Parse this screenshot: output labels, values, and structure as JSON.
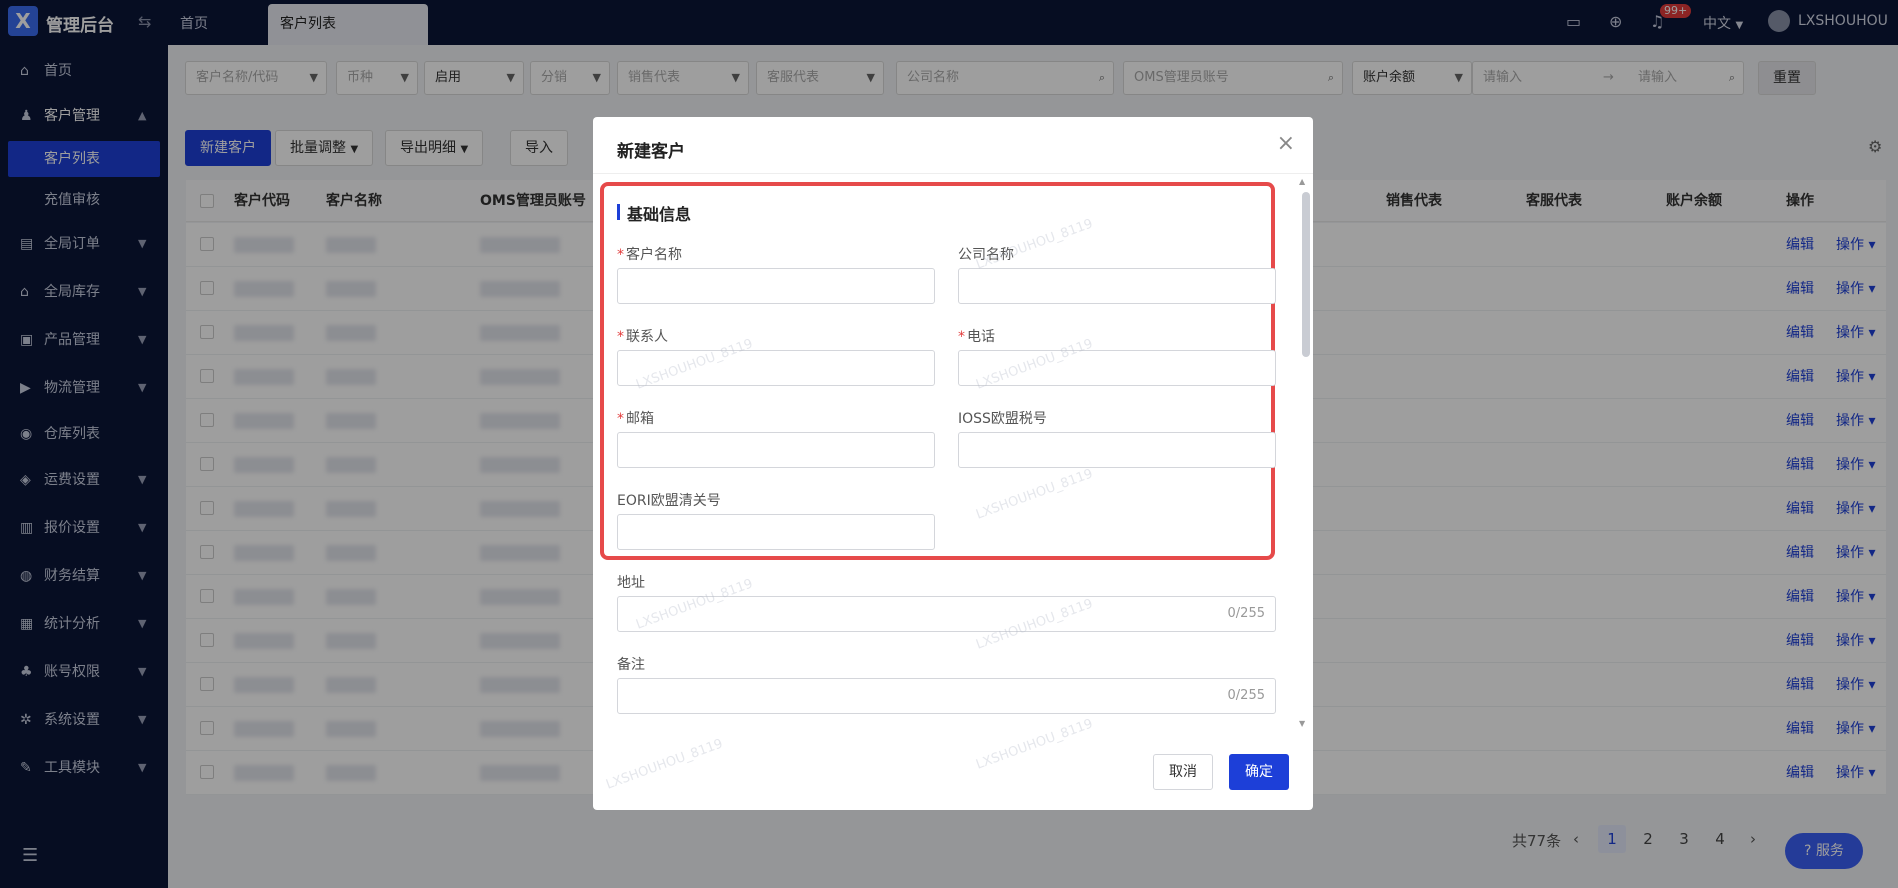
{
  "app": {
    "title": "管理后台"
  },
  "top_tabs": [
    {
      "label": "首页"
    },
    {
      "label": "客户列表"
    }
  ],
  "header": {
    "notification_badge": "99+",
    "language": "中文",
    "username": "LXSHOUHOU"
  },
  "sidebar": {
    "items": [
      {
        "label": "首页",
        "icon": "home-icon"
      },
      {
        "label": "客户管理",
        "icon": "user-icon"
      },
      {
        "label": "客户列表"
      },
      {
        "label": "充值审核"
      },
      {
        "label": "全局订单",
        "icon": "order-icon"
      },
      {
        "label": "全局库存",
        "icon": "warehouse-icon"
      },
      {
        "label": "产品管理",
        "icon": "product-icon"
      },
      {
        "label": "物流管理",
        "icon": "truck-icon"
      },
      {
        "label": "仓库列表",
        "icon": "location-icon"
      },
      {
        "label": "运费设置",
        "icon": "box-icon"
      },
      {
        "label": "报价设置",
        "icon": "document-icon"
      },
      {
        "label": "财务结算",
        "icon": "money-icon"
      },
      {
        "label": "统计分析",
        "icon": "chart-icon"
      },
      {
        "label": "账号权限",
        "icon": "org-icon"
      },
      {
        "label": "系统设置",
        "icon": "gear-icon"
      },
      {
        "label": "工具模块",
        "icon": "wrench-icon"
      }
    ]
  },
  "filters": {
    "customer": "客户名称/代码",
    "currency": "币种",
    "status": "启用",
    "distribution": "分销",
    "sales_rep": "销售代表",
    "service_rep": "客服代表",
    "company": "公司名称",
    "oms_account": "OMS管理员账号",
    "balance_type": "账户余额",
    "range_from": "请输入",
    "range_to": "请输入",
    "reset": "重置"
  },
  "toolbar": {
    "new_customer": "新建客户",
    "batch_adjust": "批量调整",
    "export_detail": "导出明细",
    "import": "导入"
  },
  "table": {
    "headers": [
      "客户代码",
      "客户名称",
      "OMS管理员账号",
      "销售代表",
      "客服代表",
      "账户余额",
      "操作"
    ],
    "edit_label": "编辑",
    "action_label": "操作"
  },
  "pagination": {
    "total": "共77条",
    "pages": [
      "1",
      "2",
      "3",
      "4"
    ]
  },
  "service": {
    "label": "服务"
  },
  "modal": {
    "title": "新建客户",
    "section_title": "基础信息",
    "fields": {
      "customer_name": "客户名称",
      "company_name": "公司名称",
      "contact": "联系人",
      "phone": "电话",
      "email": "邮箱",
      "ioss": "IOSS欧盟税号",
      "eori": "EORI欧盟清关号",
      "address": "地址",
      "remark": "备注"
    },
    "address_counter": "0/255",
    "remark_counter": "0/255",
    "cancel": "取消",
    "confirm": "确定"
  },
  "watermark": "LXSHOUHOU_8119"
}
